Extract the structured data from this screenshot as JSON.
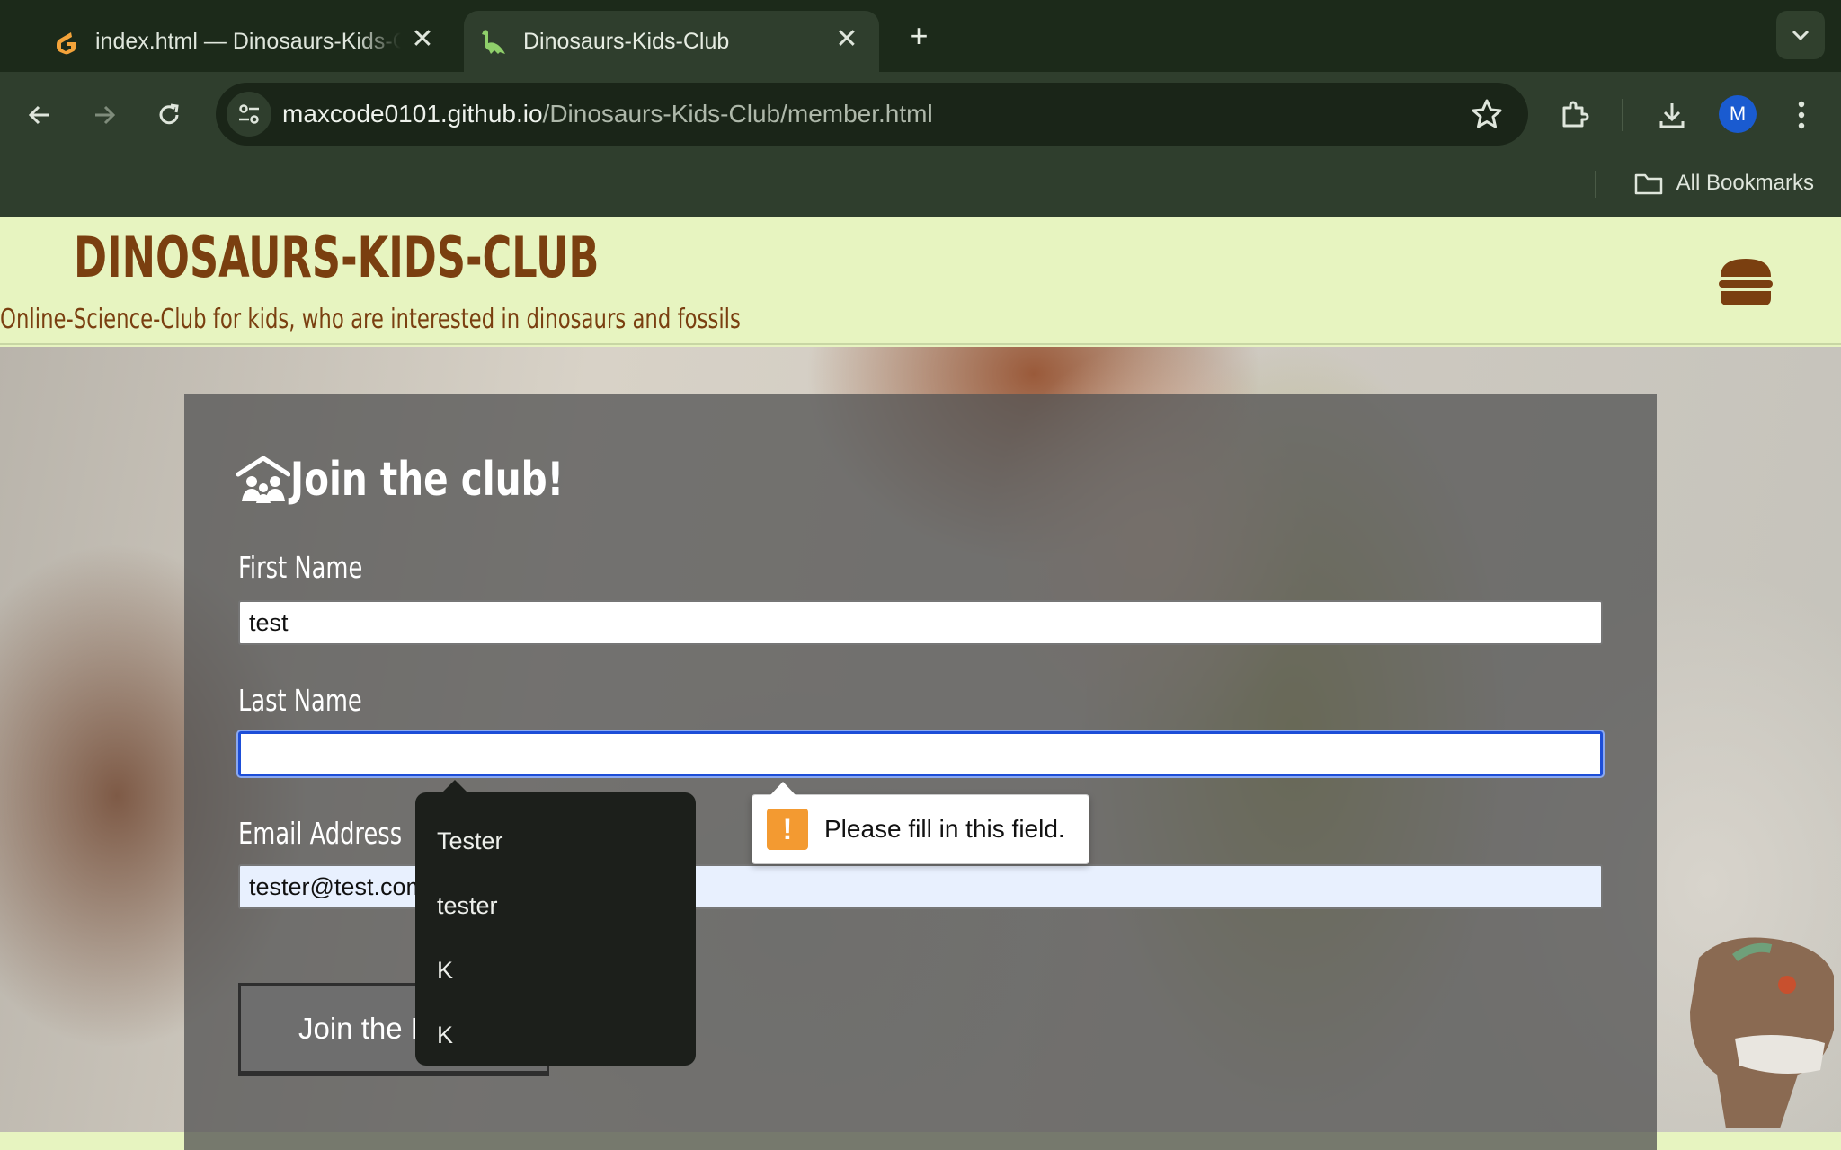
{
  "browser": {
    "tabs": [
      {
        "title": "index.html — Dinosaurs-Kids-Club",
        "favicon": "gitpod-icon",
        "active": false
      },
      {
        "title": "Dinosaurs-Kids-Club",
        "favicon": "dinosaur-icon",
        "active": true
      }
    ],
    "url_host": "maxcode0101.github.io",
    "url_path": "/Dinosaurs-Kids-Club/member.html",
    "profile_initial": "M",
    "bookmarks_label": "All Bookmarks"
  },
  "site": {
    "title": "DINOSAURS-KIDS-CLUB",
    "tagline": "Online-Science-Club for kids, who are interested in dinosaurs and fossils",
    "menu_icon": "hamburger-icon"
  },
  "form": {
    "heading": "Join the club!",
    "heading_icon": "people-roof-icon",
    "first_name_label": "First Name",
    "first_name_value": "test",
    "last_name_label": "Last Name",
    "last_name_value": "",
    "email_label": "Email Address",
    "email_value": "tester@test.com",
    "submit_label": "Join the D"
  },
  "autocomplete": {
    "items": [
      "Tester",
      "tester",
      "K",
      "K"
    ]
  },
  "validation": {
    "icon": "!",
    "message": "Please fill in this field."
  },
  "colors": {
    "brand_brown": "#7a3f10",
    "header_bg": "#e7f4c0",
    "chrome_dark": "#1c2a1a",
    "focus_blue": "#1d4ed8",
    "warning_orange": "#f39a31"
  }
}
